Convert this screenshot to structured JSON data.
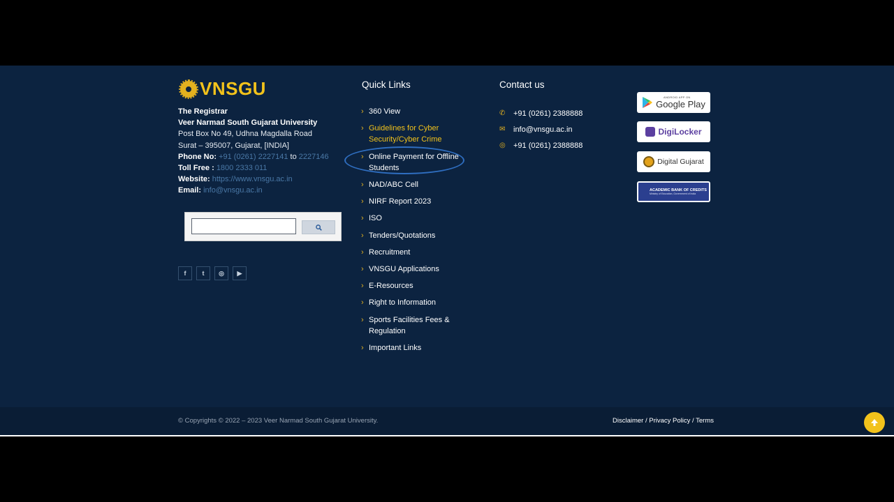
{
  "brand": {
    "name": "VNSGU"
  },
  "address": {
    "registrar": "The Registrar",
    "university": "Veer Narmad South Gujarat University",
    "line1": "Post Box No 49, Udhna Magdalla Road",
    "line2": "Surat – 395007, Gujarat, [INDIA]",
    "phone_label": "Phone No:",
    "phone_value": "+91 (0261) 2227141",
    "phone_to": "to",
    "phone_value2": "2227146",
    "toll_label": "Toll Free :",
    "toll_value": "1800 2333 011",
    "website_label": "Website:",
    "website_value": "https://www.vnsgu.ac.in",
    "email_label": "Email:",
    "email_value": "info@vnsgu.ac.in"
  },
  "search": {
    "value": "",
    "icon": "search-icon"
  },
  "social": [
    {
      "name": "facebook",
      "glyph": "f"
    },
    {
      "name": "twitter",
      "glyph": "t"
    },
    {
      "name": "instagram",
      "glyph": "◎"
    },
    {
      "name": "youtube",
      "glyph": "▶"
    }
  ],
  "quick_links": {
    "title": "Quick Links",
    "items": [
      "360 View",
      "Guidelines for Cyber Security/Cyber Crime",
      "Online Payment for Offline Students",
      "NAD/ABC Cell",
      "NIRF Report 2023",
      "ISO",
      "Tenders/Quotations",
      "Recruitment",
      "VNSGU Applications",
      "E-Resources",
      "Right to Information",
      "Sports Facilities Fees & Regulation",
      "Important Links"
    ]
  },
  "contact": {
    "title": "Contact us",
    "phone": "+91 (0261) 2388888",
    "email": "info@vnsgu.ac.in",
    "whatsapp": "+91 (0261) 2388888"
  },
  "badges": {
    "google_play_small": "ANDROID APP ON",
    "google_play": "Google Play",
    "digilocker": "DigiLocker",
    "digital_gujarat": "Digital Gujarat",
    "abc": "ACADEMIC BANK OF CREDITS",
    "abc_sub": "Ministry of Education, Government of India"
  },
  "footer": {
    "copyright": "© Copyrights © 2022 – 2023 Veer Narmad South Gujarat University.",
    "disclaimer": "Disclaimer",
    "privacy": "Privacy Policy",
    "terms": "Terms",
    "sep": "/"
  },
  "colors": {
    "background": "#0c2340",
    "accent": "#f2c21b",
    "link": "#4a78a6"
  }
}
